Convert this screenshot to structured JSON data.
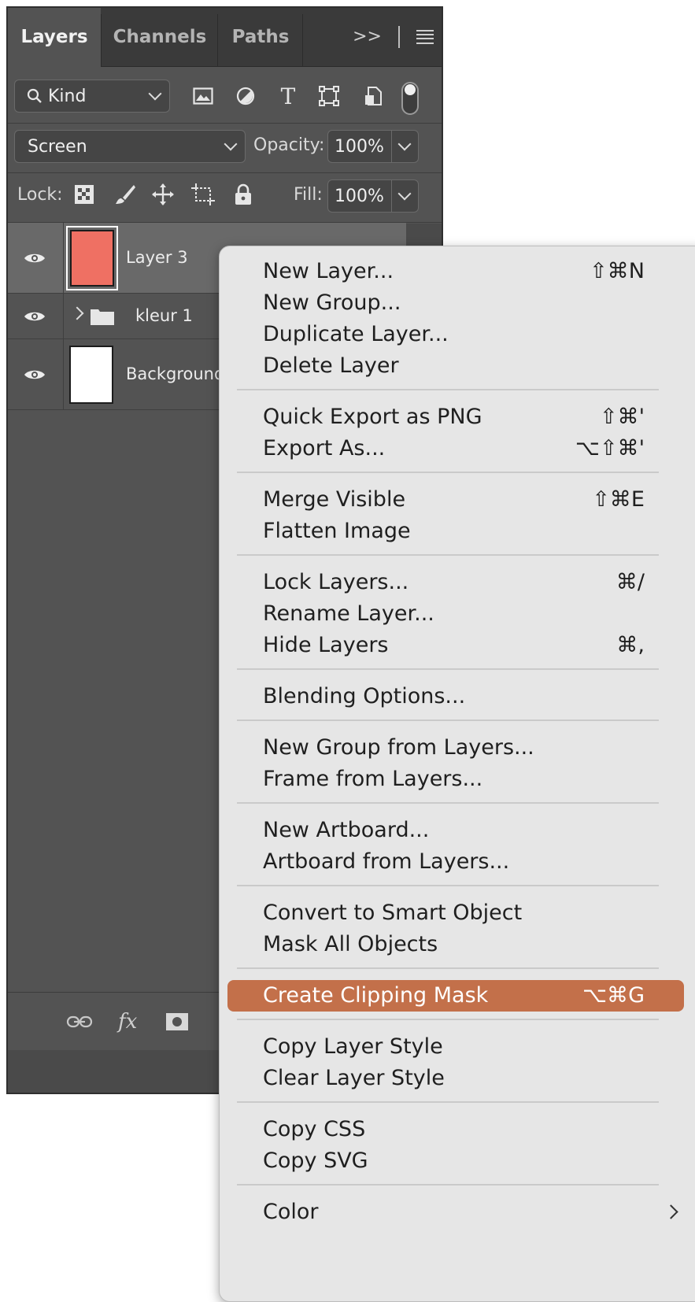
{
  "tabs": [
    {
      "label": "Layers",
      "active": true
    },
    {
      "label": "Channels",
      "active": false
    },
    {
      "label": "Paths",
      "active": false
    }
  ],
  "tabs_overflow": ">>",
  "filter": {
    "kind_label": "Kind"
  },
  "blend": {
    "mode": "Screen",
    "opacity_label": "Opacity:",
    "opacity_value": "100%"
  },
  "lock": {
    "label": "Lock:",
    "fill_label": "Fill:",
    "fill_value": "100%"
  },
  "layers": [
    {
      "name": "Layer 3",
      "thumb_color": "#ef7063",
      "selected": true
    },
    {
      "name": "kleur 1",
      "type": "group"
    },
    {
      "name": "Background",
      "thumb_color": "#ffffff"
    }
  ],
  "bottom_bar": {
    "fx_label": "fx"
  },
  "menu": [
    {
      "label": "New Layer...",
      "shortcut": "⇧⌘N"
    },
    {
      "label": "New Group...",
      "shortcut": ""
    },
    {
      "label": "Duplicate Layer...",
      "shortcut": ""
    },
    {
      "label": "Delete Layer",
      "shortcut": ""
    },
    {
      "label": "Quick Export as PNG",
      "shortcut": "⇧⌘'"
    },
    {
      "label": "Export As...",
      "shortcut": "⌥⇧⌘'"
    },
    {
      "label": "Merge Visible",
      "shortcut": "⇧⌘E"
    },
    {
      "label": "Flatten Image",
      "shortcut": ""
    },
    {
      "label": "Lock Layers...",
      "shortcut": "⌘/"
    },
    {
      "label": "Rename Layer...",
      "shortcut": ""
    },
    {
      "label": "Hide Layers",
      "shortcut": "⌘,"
    },
    {
      "label": "Blending Options...",
      "shortcut": ""
    },
    {
      "label": "New Group from Layers...",
      "shortcut": ""
    },
    {
      "label": "Frame from Layers...",
      "shortcut": ""
    },
    {
      "label": "New Artboard...",
      "shortcut": ""
    },
    {
      "label": "Artboard from Layers...",
      "shortcut": ""
    },
    {
      "label": "Convert to Smart Object",
      "shortcut": ""
    },
    {
      "label": "Mask All Objects",
      "shortcut": ""
    },
    {
      "label": "Create Clipping Mask",
      "shortcut": "⌥⌘G",
      "highlighted": true
    },
    {
      "label": "Copy Layer Style",
      "shortcut": ""
    },
    {
      "label": "Clear Layer Style",
      "shortcut": ""
    },
    {
      "label": "Copy CSS",
      "shortcut": ""
    },
    {
      "label": "Copy SVG",
      "shortcut": ""
    },
    {
      "label": "Color",
      "shortcut": "",
      "submenu": true
    }
  ],
  "colors": {
    "highlight": "#c3704a",
    "panel_bg": "#535353",
    "menu_bg": "#e6e6e6"
  }
}
